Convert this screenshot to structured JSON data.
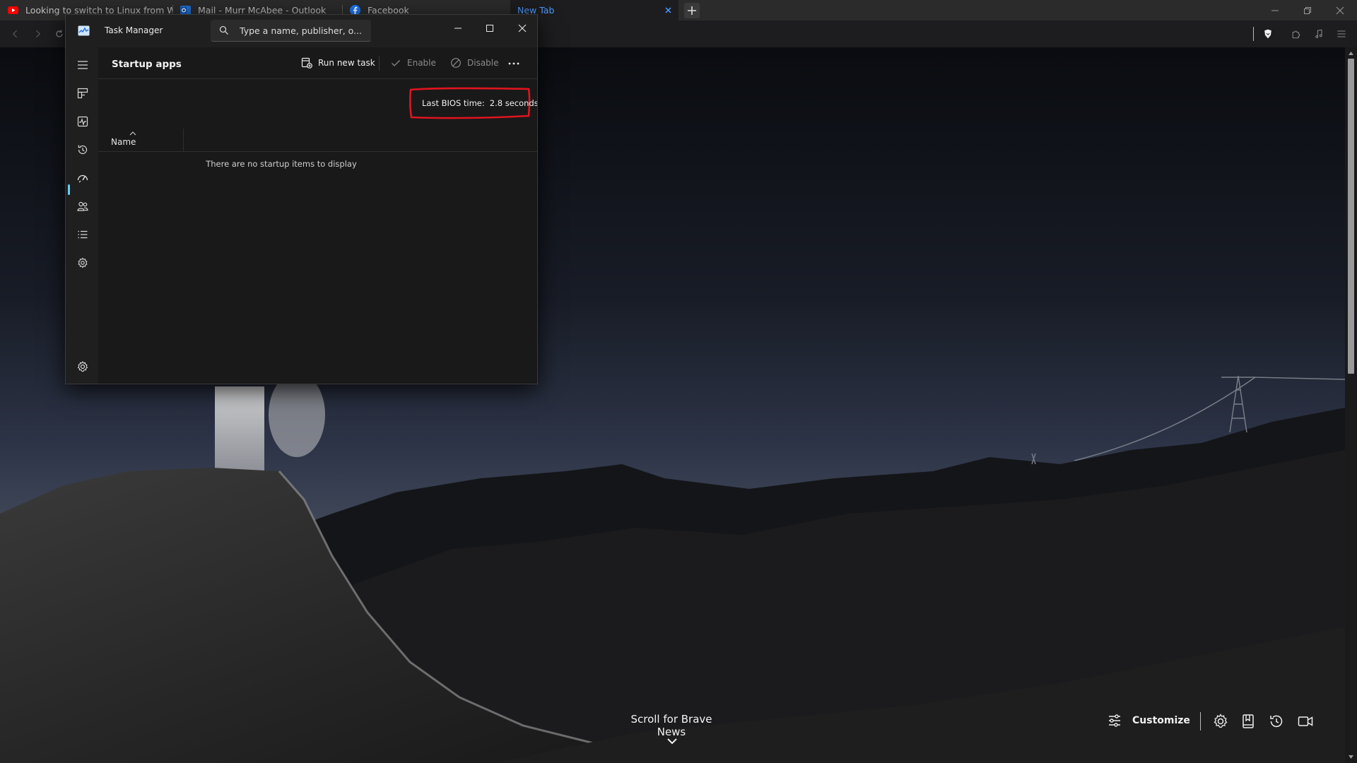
{
  "browser": {
    "tabs": [
      {
        "title": "Looking to switch to Linux from Wind",
        "favicon": "youtube-icon"
      },
      {
        "title": "Mail - Murr McAbee - Outlook",
        "favicon": "outlook-icon"
      },
      {
        "title": "Facebook",
        "favicon": "facebook-icon"
      },
      {
        "title": "New Tab",
        "favicon": "",
        "active": true
      }
    ],
    "accent_color": "#4d9bff"
  },
  "task_manager": {
    "title": "Task Manager",
    "search_placeholder": "Type a name, publisher, o...",
    "page_title": "Startup apps",
    "actions": {
      "run_new_task": "Run new task",
      "enable": "Enable",
      "disable": "Disable"
    },
    "bios": {
      "label": "Last BIOS time:",
      "value": "2.8 seconds"
    },
    "columns": {
      "name": "Name"
    },
    "empty_message": "There are no startup items to display",
    "nav_items": [
      "hamburger-menu-icon",
      "processes-icon",
      "performance-icon",
      "app-history-icon",
      "startup-apps-icon",
      "users-icon",
      "details-icon",
      "services-icon",
      "settings-icon"
    ],
    "highlight_color": "#e0141e"
  },
  "new_tab_page": {
    "brave_news": "Scroll for Brave News",
    "customize": "Customize"
  }
}
